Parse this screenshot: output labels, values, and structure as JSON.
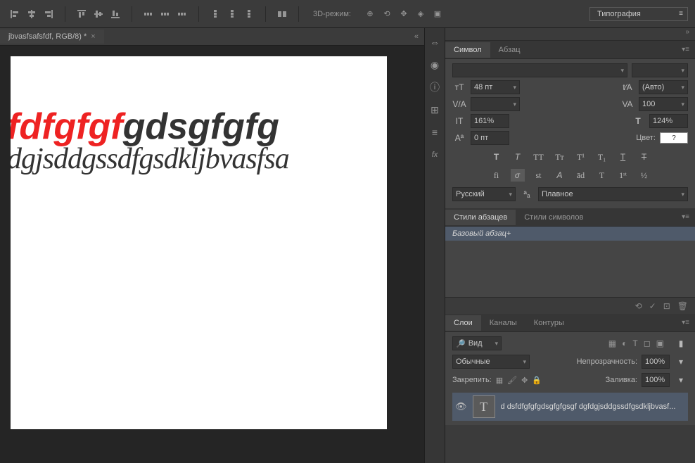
{
  "toolbar": {
    "mode_label": "3D-режим:",
    "workspace": "Типография"
  },
  "document": {
    "tab_title": "jbvasfsafsfdf, RGB/8) *",
    "text_line_1_red": "fdfgfgf",
    "text_line_1_dark": "gdsgfgfg",
    "text_line_2": "dgjsddgssdfgsdkljbvasfsa"
  },
  "character": {
    "tab_symbol": "Символ",
    "tab_paragraph": "Абзац",
    "font_size": "48 пт",
    "leading": "(Авто)",
    "tracking": "100",
    "scale_h": "161%",
    "scale_v": "124%",
    "baseline": "0 пт",
    "color_label": "Цвет:",
    "color_value": "?",
    "language": "Русский",
    "antialias": "Плавное"
  },
  "styles": {
    "tab_para": "Стили абзацев",
    "tab_char": "Стили символов",
    "base_style": "Базовый абзац+"
  },
  "layers": {
    "tab_layers": "Слои",
    "tab_channels": "Каналы",
    "tab_paths": "Контуры",
    "filter_kind": "Вид",
    "blend_mode": "Обычные",
    "opacity_label": "Непрозрачность:",
    "opacity_value": "100%",
    "lock_label": "Закрепить:",
    "fill_label": "Заливка:",
    "fill_value": "100%",
    "layer_name": "d dsfdfgfgfgdsgfgfgsgf dgfdgjsddgssdfgsdkljbvasf..."
  }
}
